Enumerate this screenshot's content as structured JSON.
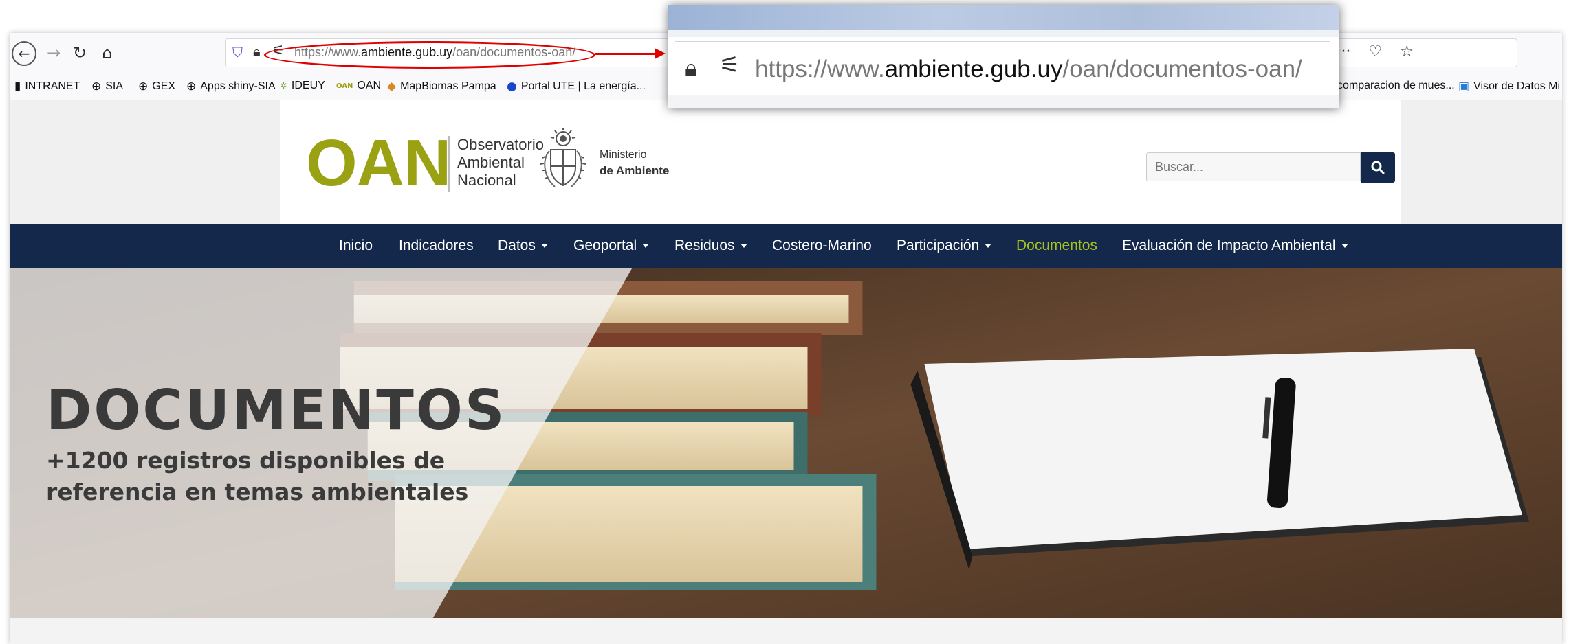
{
  "browser": {
    "back_icon": "back-arrow-icon",
    "forward_icon": "forward-arrow-icon",
    "reload_icon": "reload-icon",
    "home_icon": "home-icon",
    "url": {
      "prefix": "https://www.",
      "domain": "ambiente.gub.uy",
      "path": "/oan/documentos-oan/"
    },
    "right_icons": [
      "reader-view-icon",
      "more-icon",
      "pocket-icon",
      "bookmark-star-icon"
    ]
  },
  "bookmarks": {
    "left": [
      {
        "label": "INTRANET",
        "icon": "page-icon"
      },
      {
        "label": "SIA",
        "icon": "globe-icon"
      },
      {
        "label": "GEX",
        "icon": "globe-icon"
      },
      {
        "label": "Apps shiny-SIA",
        "icon": "globe-icon"
      },
      {
        "label": "IDEUY",
        "icon": "ideuy-icon"
      },
      {
        "label": "OAN",
        "icon": "oan-icon"
      },
      {
        "label": "MapBiomas Pampa",
        "icon": "mapbiomas-icon"
      },
      {
        "label": "Portal UTE | La energía...",
        "icon": "ute-icon"
      }
    ],
    "right": [
      {
        "label": "comparacion de mues...",
        "icon": ""
      },
      {
        "label": "Visor de Datos Mi",
        "icon": "visor-icon"
      }
    ]
  },
  "site": {
    "logo_text": "OAN",
    "logo_lines": [
      "Observatorio",
      "Ambiental",
      "Nacional"
    ],
    "ministry_lines": [
      "Ministerio",
      "de Ambiente"
    ],
    "search_placeholder": "Buscar...",
    "search_icon": "magnifier-icon",
    "colors": {
      "nav_bg": "#14284b",
      "logo_green": "#9aa112",
      "active_nav": "#a8c21c"
    }
  },
  "nav": {
    "items": [
      {
        "label": "Inicio",
        "dropdown": false,
        "active": false
      },
      {
        "label": "Indicadores",
        "dropdown": false,
        "active": false
      },
      {
        "label": "Datos",
        "dropdown": true,
        "active": false
      },
      {
        "label": "Geoportal",
        "dropdown": true,
        "active": false
      },
      {
        "label": "Residuos",
        "dropdown": true,
        "active": false
      },
      {
        "label": "Costero-Marino",
        "dropdown": false,
        "active": false
      },
      {
        "label": "Participación",
        "dropdown": true,
        "active": false
      },
      {
        "label": "Documentos",
        "dropdown": false,
        "active": true
      },
      {
        "label": "Evaluación de Impacto Ambiental",
        "dropdown": true,
        "active": false
      }
    ]
  },
  "hero": {
    "title": "DOCUMENTOS",
    "subtitle_lines": [
      "+1200 registros disponibles de",
      "referencia en temas ambientales"
    ]
  },
  "zoom_callout": {
    "url_prefix": "https://www.",
    "url_domain": "ambiente.gub.uy",
    "url_path": "/oan/documentos-oan/"
  }
}
